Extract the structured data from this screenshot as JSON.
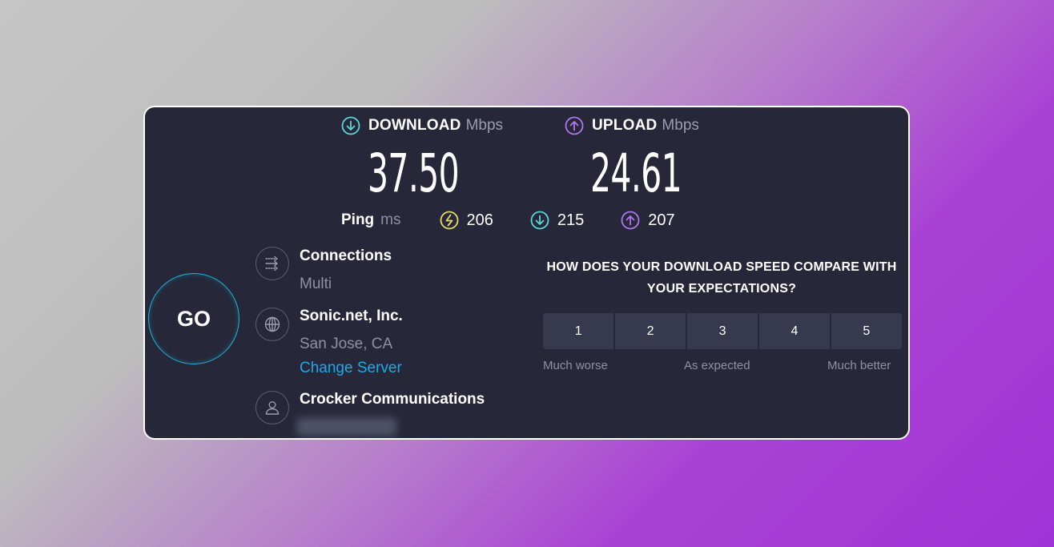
{
  "download": {
    "title": "DOWNLOAD",
    "unit": "Mbps",
    "value": "37.50",
    "icon": "download-arrow-icon",
    "color": "#5ad6d8"
  },
  "upload": {
    "title": "UPLOAD",
    "unit": "Mbps",
    "value": "24.61",
    "icon": "upload-arrow-icon",
    "color": "#b374ef"
  },
  "ping": {
    "label": "Ping",
    "unit": "ms",
    "idle": {
      "value": "206",
      "icon": "ping-idle-icon",
      "color": "#e8d86a"
    },
    "download": {
      "value": "215",
      "icon": "download-arrow-icon",
      "color": "#5ad6d8"
    },
    "upload": {
      "value": "207",
      "icon": "upload-arrow-icon",
      "color": "#b374ef"
    }
  },
  "go_button": {
    "label": "GO",
    "color": "#1fb3d5"
  },
  "connections": {
    "title": "Connections",
    "value": "Multi",
    "icon": "connections-icon"
  },
  "server": {
    "name": "Sonic.net, Inc.",
    "location": "San Jose, CA",
    "change_label": "Change Server",
    "icon": "globe-icon",
    "link_color": "#1fa9e8"
  },
  "isp": {
    "name": "Crocker Communications",
    "icon": "user-icon"
  },
  "survey": {
    "question": "HOW DOES YOUR DOWNLOAD SPEED COMPARE WITH YOUR EXPECTATIONS?",
    "options": [
      "1",
      "2",
      "3",
      "4",
      "5"
    ],
    "labels": {
      "low": "Much worse",
      "mid": "As expected",
      "high": "Much better"
    }
  }
}
